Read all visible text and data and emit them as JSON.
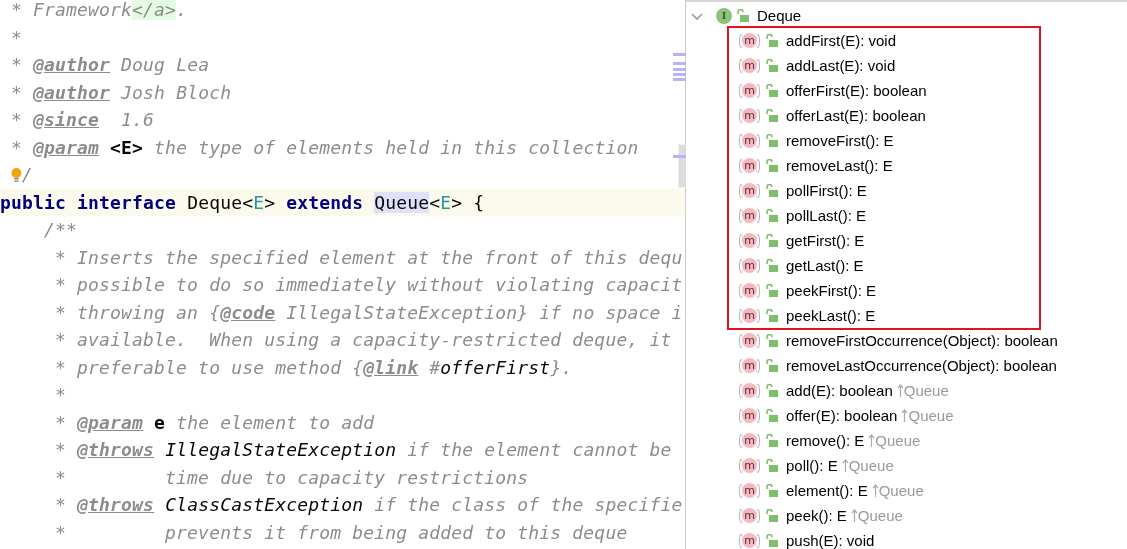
{
  "editor": {
    "lines": [
      {
        "current": false,
        "segments": [
          {
            "kind": "comment",
            "text": " * Framework"
          },
          {
            "kind": "html",
            "text": "</a>"
          },
          {
            "kind": "comment",
            "text": "."
          }
        ]
      },
      {
        "current": false,
        "segments": [
          {
            "kind": "comment",
            "text": " *"
          }
        ]
      },
      {
        "current": false,
        "segments": [
          {
            "kind": "comment",
            "text": " * "
          },
          {
            "kind": "tag",
            "text": "@author"
          },
          {
            "kind": "comment",
            "text": " Doug Lea"
          }
        ]
      },
      {
        "current": false,
        "segments": [
          {
            "kind": "comment",
            "text": " * "
          },
          {
            "kind": "tag",
            "text": "@author"
          },
          {
            "kind": "comment",
            "text": " Josh Bloch"
          }
        ]
      },
      {
        "current": false,
        "segments": [
          {
            "kind": "comment",
            "text": " * "
          },
          {
            "kind": "tag",
            "text": "@since"
          },
          {
            "kind": "comment",
            "text": "  1.6"
          }
        ]
      },
      {
        "current": false,
        "segments": [
          {
            "kind": "comment",
            "text": " * "
          },
          {
            "kind": "tag",
            "text": "@param"
          },
          {
            "kind": "tag-arg",
            "text": " <E>"
          },
          {
            "kind": "comment",
            "text": " the type of elements held in this collection"
          }
        ]
      },
      {
        "current": false,
        "segments": [
          {
            "kind": "bulb"
          },
          {
            "kind": "comment",
            "text": "/"
          }
        ]
      },
      {
        "current": true,
        "segments": [
          {
            "kind": "keyword",
            "text": "public"
          },
          {
            "kind": "keyword",
            "text": " interface"
          },
          {
            "kind": "plain",
            "text": " Deque<"
          },
          {
            "kind": "type-param",
            "text": "E"
          },
          {
            "kind": "plain",
            "text": "> "
          },
          {
            "kind": "keyword",
            "text": "extends "
          },
          {
            "kind": "usage",
            "text": "Queue"
          },
          {
            "kind": "plain",
            "text": "<"
          },
          {
            "kind": "type-param",
            "text": "E"
          },
          {
            "kind": "plain",
            "text": "> {"
          }
        ]
      },
      {
        "current": false,
        "segments": [
          {
            "kind": "comment",
            "text": "    /**"
          }
        ]
      },
      {
        "current": false,
        "segments": [
          {
            "kind": "comment",
            "text": "     * Inserts the specified element at the front of this dequ"
          }
        ]
      },
      {
        "current": false,
        "segments": [
          {
            "kind": "comment",
            "text": "     * possible to do so immediately without violating capacit"
          }
        ]
      },
      {
        "current": false,
        "segments": [
          {
            "kind": "comment",
            "text": "     * throwing an {"
          },
          {
            "kind": "tag",
            "text": "@code"
          },
          {
            "kind": "comment",
            "text": " IllegalStateException} if no space i"
          }
        ]
      },
      {
        "current": false,
        "segments": [
          {
            "kind": "comment",
            "text": "     * available.  When using a capacity-restricted deque, it"
          }
        ]
      },
      {
        "current": false,
        "segments": [
          {
            "kind": "comment",
            "text": "     * preferable to use method {"
          },
          {
            "kind": "tag",
            "text": "@link"
          },
          {
            "kind": "comment",
            "text": " #"
          },
          {
            "kind": "ref",
            "text": "offerFirst"
          },
          {
            "kind": "comment",
            "text": "}."
          }
        ]
      },
      {
        "current": false,
        "segments": [
          {
            "kind": "comment",
            "text": "     *"
          }
        ]
      },
      {
        "current": false,
        "segments": [
          {
            "kind": "comment",
            "text": "     * "
          },
          {
            "kind": "tag",
            "text": "@param"
          },
          {
            "kind": "tag-arg",
            "text": " e"
          },
          {
            "kind": "comment",
            "text": " the element to add"
          }
        ]
      },
      {
        "current": false,
        "segments": [
          {
            "kind": "comment",
            "text": "     * "
          },
          {
            "kind": "tag",
            "text": "@throws"
          },
          {
            "kind": "ref",
            "text": " IllegalStateException"
          },
          {
            "kind": "comment",
            "text": " if the element cannot be"
          }
        ]
      },
      {
        "current": false,
        "segments": [
          {
            "kind": "comment",
            "text": "     *         time due to capacity restrictions"
          }
        ]
      },
      {
        "current": false,
        "segments": [
          {
            "kind": "comment",
            "text": "     * "
          },
          {
            "kind": "tag",
            "text": "@throws"
          },
          {
            "kind": "ref",
            "text": " ClassCastException"
          },
          {
            "kind": "comment",
            "text": " if the class of the specifie"
          }
        ]
      },
      {
        "current": false,
        "segments": [
          {
            "kind": "comment",
            "text": "     *         prevents it from being added to this deque"
          }
        ]
      }
    ]
  },
  "structure": {
    "root": {
      "label": "Deque",
      "icon_letter": "I",
      "expanded": true
    },
    "methods": [
      {
        "icon_letter": "m",
        "signature": "addFirst(E): void",
        "marked": true
      },
      {
        "icon_letter": "m",
        "signature": "addLast(E): void",
        "marked": true
      },
      {
        "icon_letter": "m",
        "signature": "offerFirst(E): boolean",
        "marked": true
      },
      {
        "icon_letter": "m",
        "signature": "offerLast(E): boolean",
        "marked": true
      },
      {
        "icon_letter": "m",
        "signature": "removeFirst(): E",
        "marked": true
      },
      {
        "icon_letter": "m",
        "signature": "removeLast(): E",
        "marked": true
      },
      {
        "icon_letter": "m",
        "signature": "pollFirst(): E",
        "marked": true
      },
      {
        "icon_letter": "m",
        "signature": "pollLast(): E",
        "marked": true
      },
      {
        "icon_letter": "m",
        "signature": "getFirst(): E",
        "marked": true
      },
      {
        "icon_letter": "m",
        "signature": "getLast(): E",
        "marked": true
      },
      {
        "icon_letter": "m",
        "signature": "peekFirst(): E",
        "marked": true
      },
      {
        "icon_letter": "m",
        "signature": "peekLast(): E",
        "marked": true
      },
      {
        "icon_letter": "m",
        "signature": "removeFirstOccurrence(Object): boolean",
        "marked": false
      },
      {
        "icon_letter": "m",
        "signature": "removeLastOccurrence(Object): boolean",
        "marked": false
      },
      {
        "icon_letter": "m",
        "signature": "add(E): boolean",
        "origin": "Queue",
        "marked": false
      },
      {
        "icon_letter": "m",
        "signature": "offer(E): boolean",
        "origin": "Queue",
        "marked": false
      },
      {
        "icon_letter": "m",
        "signature": "remove(): E",
        "origin": "Queue",
        "marked": false
      },
      {
        "icon_letter": "m",
        "signature": "poll(): E",
        "origin": "Queue",
        "marked": false
      },
      {
        "icon_letter": "m",
        "signature": "element(): E",
        "origin": "Queue",
        "marked": false
      },
      {
        "icon_letter": "m",
        "signature": "peek(): E",
        "origin": "Queue",
        "marked": false
      },
      {
        "icon_letter": "m",
        "signature": "push(E): void",
        "marked": false
      }
    ]
  }
}
